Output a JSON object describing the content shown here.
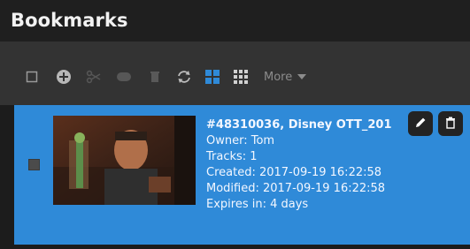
{
  "header": {
    "title": "Bookmarks"
  },
  "toolbar": {
    "icons": [
      "checkbox-icon",
      "add-circle-icon",
      "scissors-icon",
      "comment-icon",
      "trash-icon",
      "refresh-icon",
      "grid-view-icon",
      "list-view-icon"
    ],
    "more_label": "More"
  },
  "bookmark": {
    "name": "#48310036, Disney OTT_201",
    "owner": "Owner: Tom",
    "tracks": "Tracks: 1",
    "created": "Created: 2017-09-19 16:22:58",
    "modified": "Modified: 2017-09-19 16:22:58",
    "expires": "Expires in: 4 days"
  },
  "colors": {
    "accent": "#2f8ad8",
    "toolbar": "#333333",
    "header": "#1f1f1f"
  }
}
